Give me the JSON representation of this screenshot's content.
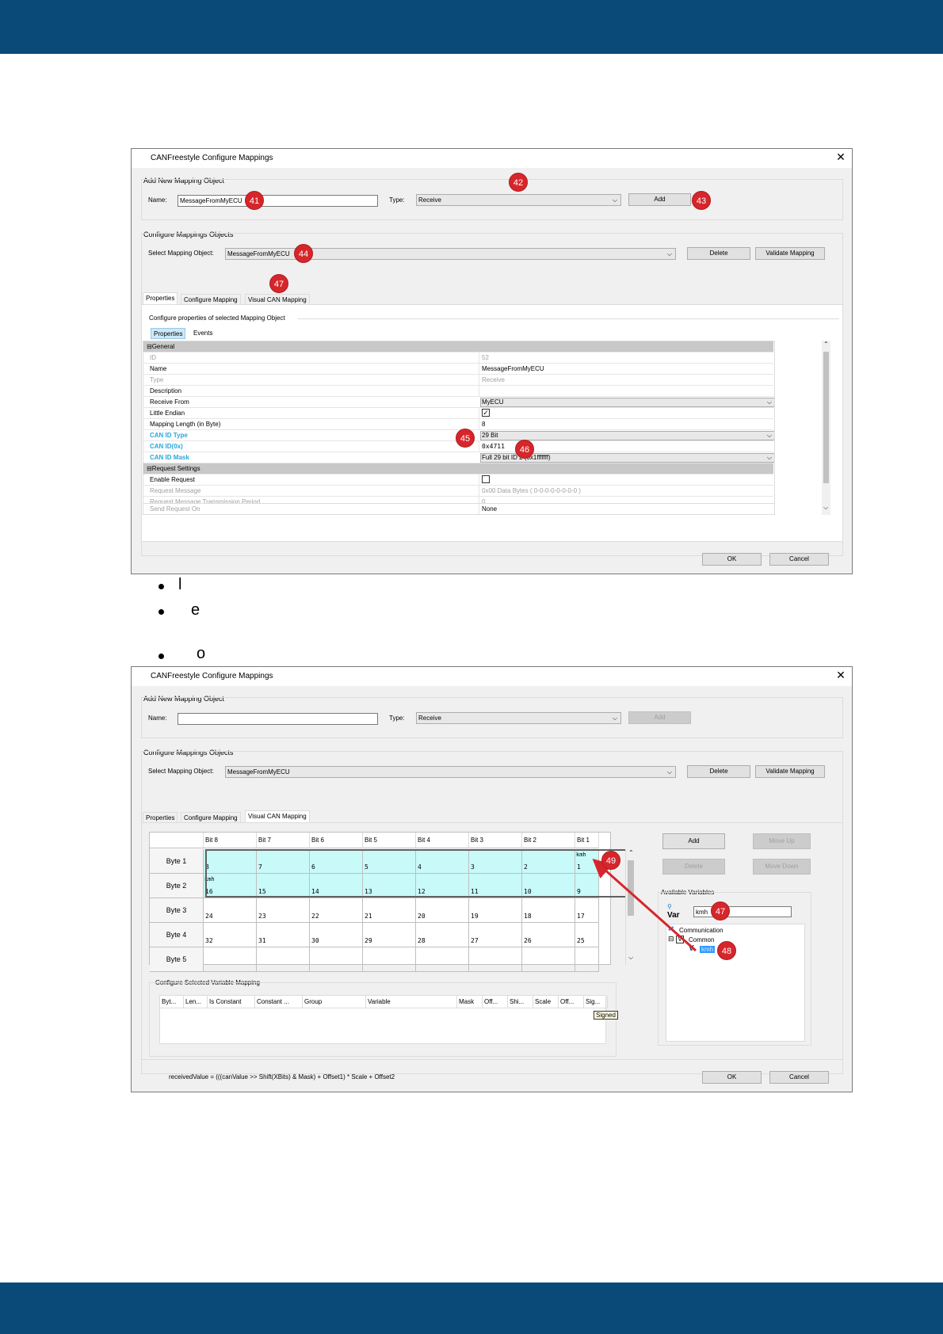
{
  "page": {
    "bullets": [
      {
        "text": "l"
      },
      {
        "text": "e"
      },
      {
        "text": "o"
      }
    ]
  },
  "dialog1": {
    "title": "CANFreestyle Configure Mappings",
    "add_group_label": "Add New Mapping Object",
    "name_label": "Name:",
    "name_value": "MessageFromMyECU",
    "type_label": "Type:",
    "type_value": "Receive",
    "add_button": "Add",
    "configure_group_label": "Configure Mappings Objects",
    "select_label": "Select Mapping Object:",
    "select_value": "MessageFromMyECU",
    "delete_button": "Delete",
    "validate_button": "Validate Mapping",
    "tabs": [
      "Properties",
      "Configure Mapping",
      "Visual CAN Mapping"
    ],
    "panel_caption": "Configure properties of selected Mapping Object",
    "subtabs": [
      "Properties",
      "Events"
    ],
    "rows": [
      {
        "key": "General",
        "value": "",
        "kind": "cat"
      },
      {
        "key": "ID",
        "value": "52",
        "kind": "grey"
      },
      {
        "key": "Name",
        "value": "MessageFromMyECU",
        "kind": "normal"
      },
      {
        "key": "Type",
        "value": "Receive",
        "kind": "grey"
      },
      {
        "key": "Description",
        "value": "",
        "kind": "normal"
      },
      {
        "key": "Receive From",
        "value": "MyECU",
        "kind": "combo"
      },
      {
        "key": "Little Endian",
        "value": "",
        "kind": "check",
        "checked": true
      },
      {
        "key": "Mapping Length (in Byte)",
        "value": "8",
        "kind": "normal"
      },
      {
        "key": "CAN ID Type",
        "value": "29 Bit",
        "kind": "blue-combo"
      },
      {
        "key": "CAN ID(0x)",
        "value": "0x4711",
        "kind": "blue"
      },
      {
        "key": "CAN ID Mask",
        "value": "Full 29 bit ID 2 (0x1fffffff)",
        "kind": "blue-combo"
      },
      {
        "key": "Request Settings",
        "value": "",
        "kind": "cat"
      },
      {
        "key": "Enable Request",
        "value": "",
        "kind": "check",
        "checked": false
      },
      {
        "key": "Request Message",
        "value": "0x00 Data Bytes ( 0-0-0-0-0-0-0-0 )",
        "kind": "grey"
      },
      {
        "key": "Request Message Transmission Period",
        "value": "0",
        "kind": "grey"
      },
      {
        "key": "Send Request On",
        "value": "None",
        "kind": "grey"
      }
    ],
    "ok_button": "OK",
    "cancel_button": "Cancel",
    "badges": [
      "41",
      "42",
      "43",
      "44",
      "45",
      "46",
      "47"
    ]
  },
  "dialog2": {
    "title": "CANFreestyle Configure Mappings",
    "add_group_label": "Add New Mapping Object",
    "name_label": "Name:",
    "name_value": "",
    "type_label": "Type:",
    "type_value": "Receive",
    "add_button": "Add",
    "configure_group_label": "Configure Mappings Objects",
    "select_label": "Select Mapping Object:",
    "select_value": "MessageFromMyECU",
    "delete_button": "Delete",
    "validate_button": "Validate Mapping",
    "tabs": [
      "Properties",
      "Configure Mapping",
      "Visual CAN Mapping"
    ],
    "bit_headers": [
      "Bit 8",
      "Bit 7",
      "Bit 6",
      "Bit 5",
      "Bit 4",
      "Bit 3",
      "Bit 2",
      "Bit 1"
    ],
    "byte_rows": [
      {
        "label": "Byte 1",
        "cells": [
          "8",
          "7",
          "6",
          "5",
          "4",
          "3",
          "2",
          "1"
        ]
      },
      {
        "label": "Byte 2",
        "cells": [
          "16",
          "15",
          "14",
          "13",
          "12",
          "11",
          "10",
          "9"
        ]
      },
      {
        "label": "Byte 3",
        "cells": [
          "24",
          "23",
          "22",
          "21",
          "20",
          "19",
          "18",
          "17"
        ]
      },
      {
        "label": "Byte 4",
        "cells": [
          "32",
          "31",
          "30",
          "29",
          "28",
          "27",
          "26",
          "25"
        ]
      },
      {
        "label": "Byte 5",
        "cells": [
          "",
          "",
          "",
          "",
          "",
          "",
          "",
          ""
        ]
      }
    ],
    "var_tag": "kmh",
    "side_buttons": {
      "add": "Add",
      "move_up": "Move Up",
      "delete": "Delete",
      "move_down": "Move Down"
    },
    "available_label": "Available Variables",
    "var_label": "Var",
    "search_value": "kmh",
    "tree": [
      "Communication",
      "Common",
      "kmh"
    ],
    "tree_check": "V",
    "tree_box_minus": "⊟",
    "mapping_group_label": "Configure Selected Variable Mapping",
    "mapping_columns": [
      "Byt...",
      "Len...",
      "Is Constant",
      "Constant ...",
      "Group",
      "Variable",
      "Mask",
      "Off...",
      "Shi...",
      "Scale",
      "Off...",
      "Sig..."
    ],
    "tooltip": "Signed",
    "formula": "receivedValue = (((canValue >> Shift(XBits) & Mask) + Offset1) * Scale + Offset2",
    "ok_button": "OK",
    "cancel_button": "Cancel",
    "badges": [
      "49",
      "47",
      "48"
    ]
  },
  "colors": {
    "brand": "#0a4a78",
    "badge": "#d6262b",
    "selected_cell": "#c8fafa",
    "property_highlight": "#2aa7d8"
  }
}
